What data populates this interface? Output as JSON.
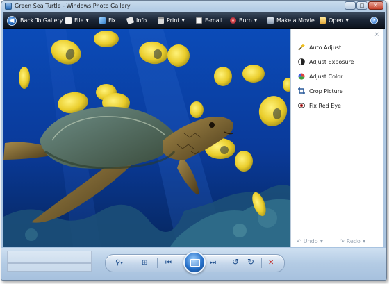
{
  "window": {
    "title": "Green Sea Turtle - Windows Photo Gallery",
    "controls": {
      "minimize": "–",
      "maximize": "□",
      "close": "✕"
    }
  },
  "toolbar": {
    "back": "Back To Gallery",
    "file": "File",
    "fix": "Fix",
    "info": "Info",
    "print": "Print",
    "email": "E-mail",
    "burn": "Burn",
    "make_movie": "Make a Movie",
    "open": "Open",
    "help": "?",
    "caret": "▼"
  },
  "fix_panel": {
    "close": "×",
    "items": [
      {
        "label": "Auto Adjust",
        "icon": "magic-wand-icon"
      },
      {
        "label": "Adjust Exposure",
        "icon": "exposure-icon"
      },
      {
        "label": "Adjust Color",
        "icon": "color-wheel-icon"
      },
      {
        "label": "Crop Picture",
        "icon": "crop-icon"
      },
      {
        "label": "Fix Red Eye",
        "icon": "eye-icon"
      }
    ],
    "undo": "Undo",
    "redo": "Redo",
    "caret": "▼"
  },
  "controls": {
    "zoom": "⚲",
    "zoom_caret": "▾",
    "actual_size": "⊞",
    "prev": "⏮",
    "next": "⏭",
    "rotate_ccw": "↺",
    "rotate_cw": "↻",
    "delete": "✕"
  },
  "colors": {
    "toolbar_dark": "#1b2636",
    "frame_blue": "#b5cde5",
    "water": "#0a3f9e",
    "delete_red": "#c0201a"
  }
}
